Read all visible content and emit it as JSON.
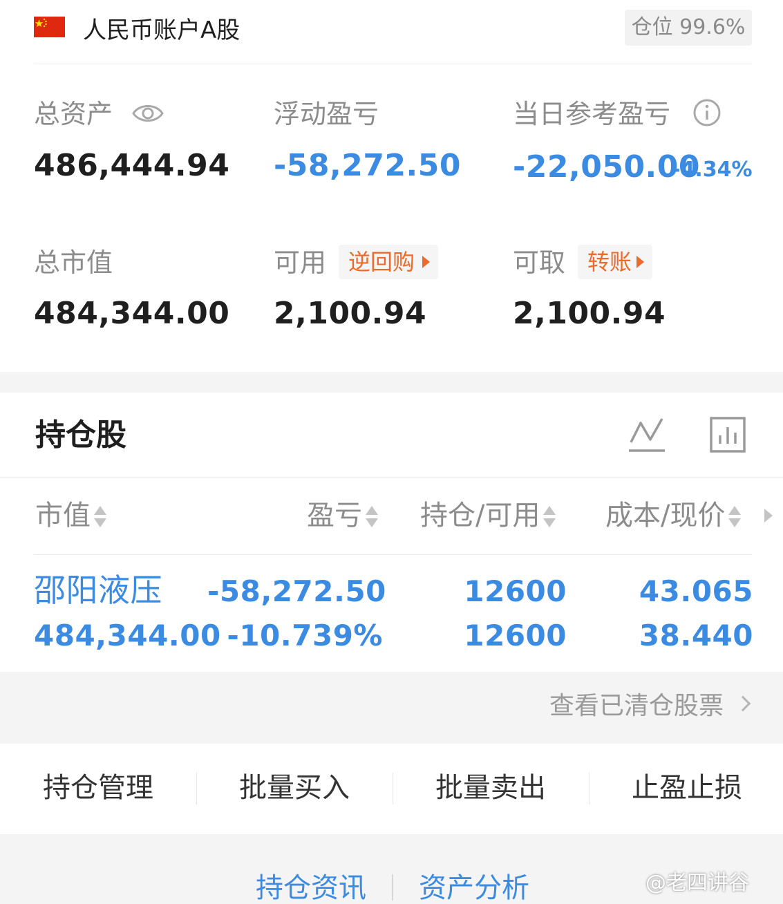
{
  "header": {
    "account_name": "人民币账户A股",
    "position_label": "仓位 99.6%"
  },
  "summary": {
    "total_assets": {
      "label": "总资产",
      "value": "486,444.94",
      "icon": "eye-icon"
    },
    "floating_pnl": {
      "label": "浮动盈亏",
      "value": "-58,272.50"
    },
    "daily_pnl": {
      "label": "当日参考盈亏",
      "value": "-22,050.00",
      "pct": "-4.34%",
      "icon": "info-icon"
    },
    "market_value": {
      "label": "总市值",
      "value": "484,344.00"
    },
    "available": {
      "label": "可用",
      "value": "2,100.94",
      "button": "逆回购"
    },
    "withdrawable": {
      "label": "可取",
      "value": "2,100.94",
      "button": "转账"
    }
  },
  "holdings": {
    "title": "持仓股",
    "icons": [
      "line-chart-icon",
      "bar-chart-icon"
    ],
    "columns": [
      "市值",
      "盈亏",
      "持仓/可用",
      "成本/现价"
    ],
    "rows": [
      {
        "name": "邵阳液压",
        "market_value": "484,344.00",
        "pnl": "-58,272.50",
        "pnl_pct": "-10.739%",
        "position": "12600",
        "available": "12600",
        "cost": "43.065",
        "price": "38.440"
      }
    ],
    "cleared_link": "查看已清仓股票"
  },
  "actions": [
    "持仓管理",
    "批量买入",
    "批量卖出",
    "止盈止损"
  ],
  "bottom": {
    "links": [
      "持仓资讯",
      "资产分析"
    ],
    "watermark": "@老四讲谷"
  },
  "colors": {
    "loss": "#3b8be3",
    "accent_orange": "#ee6a2a",
    "label_gray": "#8c8c8c",
    "flag_red": "#de2910"
  }
}
